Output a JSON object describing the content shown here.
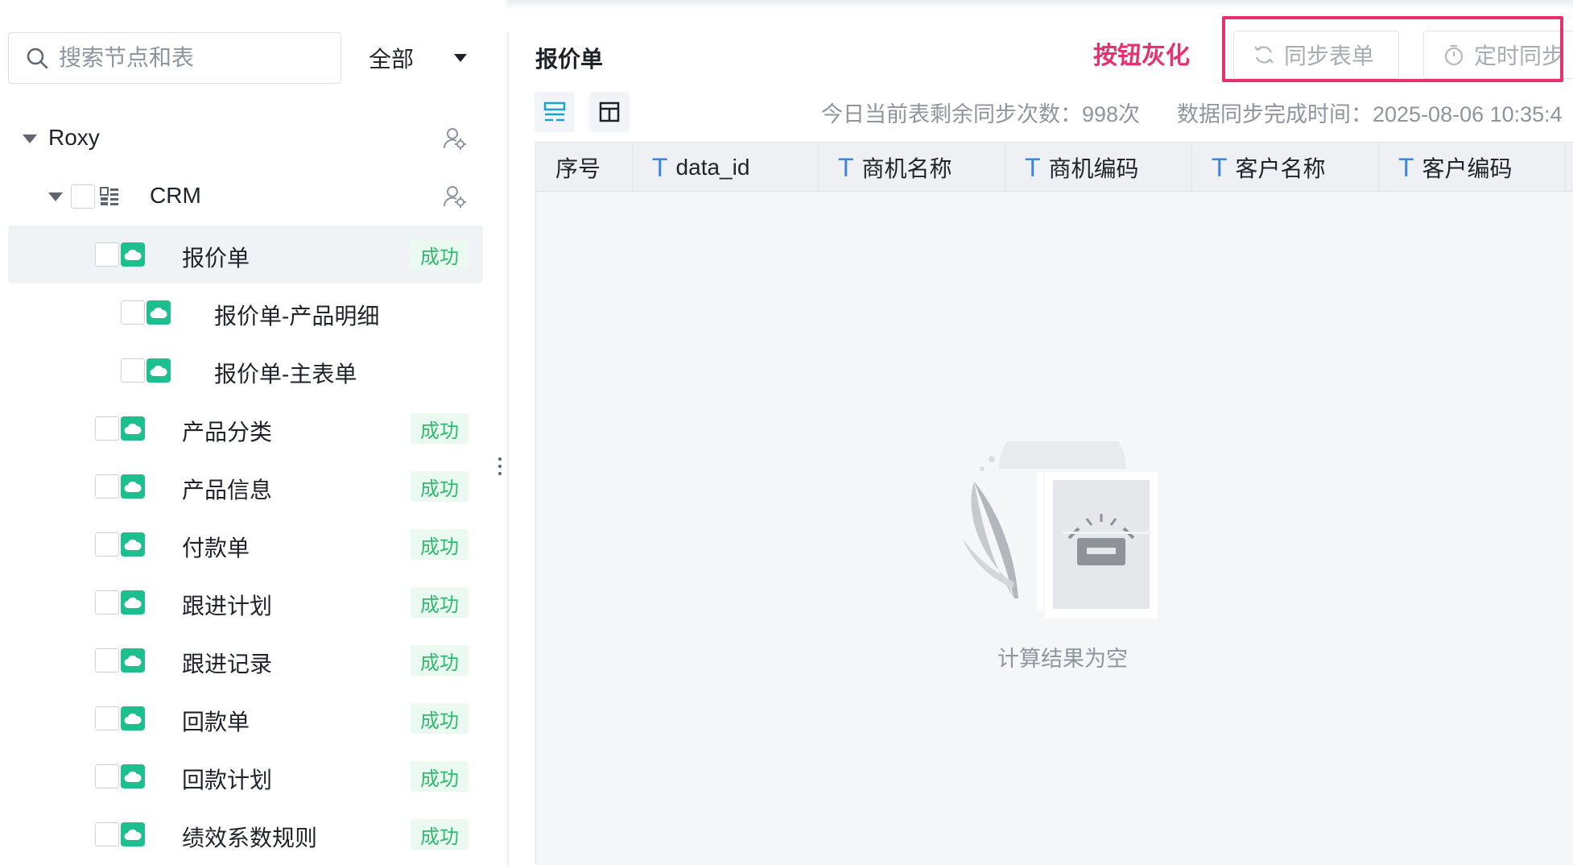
{
  "sidebar": {
    "search_placeholder": "搜索节点和表",
    "scope_select": "全部",
    "tree": [
      {
        "label": "Roxy",
        "level": 0,
        "expanded": true,
        "has_checkbox": false,
        "icon": "none",
        "has_person_icon": true
      },
      {
        "label": "CRM",
        "level": 1,
        "expanded": true,
        "has_checkbox": true,
        "icon": "app-grid-icon",
        "has_person_icon": true
      },
      {
        "label": "报价单",
        "level": 2,
        "selected": true,
        "icon": "cloud-icon",
        "status": "成功"
      },
      {
        "label": "报价单-产品明细",
        "level": 3,
        "icon": "cloud-icon",
        "status": ""
      },
      {
        "label": "报价单-主表单",
        "level": 3,
        "icon": "cloud-icon",
        "status": ""
      },
      {
        "label": "产品分类",
        "level": 2,
        "icon": "cloud-icon",
        "status": "成功"
      },
      {
        "label": "产品信息",
        "level": 2,
        "icon": "cloud-icon",
        "status": "成功"
      },
      {
        "label": "付款单",
        "level": 2,
        "icon": "cloud-icon",
        "status": "成功"
      },
      {
        "label": "跟进计划",
        "level": 2,
        "icon": "cloud-icon",
        "status": "成功"
      },
      {
        "label": "跟进记录",
        "level": 2,
        "icon": "cloud-icon",
        "status": "成功"
      },
      {
        "label": "回款单",
        "level": 2,
        "icon": "cloud-icon",
        "status": "成功"
      },
      {
        "label": "回款计划",
        "level": 2,
        "icon": "cloud-icon",
        "status": "成功"
      },
      {
        "label": "绩效系数规则",
        "level": 2,
        "icon": "cloud-icon",
        "status": "成功"
      }
    ]
  },
  "main": {
    "title": "报价单",
    "annotation": "按钮灰化",
    "buttons": {
      "sync_table": "同步表单",
      "scheduled_sync": "定时同步"
    },
    "meta": {
      "remaining_syncs": "今日当前表剩余同步次数：998次",
      "sync_time": "数据同步完成时间：2025-08-06 10:35:4"
    },
    "columns": [
      "序号",
      "data_id",
      "商机名称",
      "商机编码",
      "客户名称",
      "客户编码"
    ],
    "empty_text": "计算结果为空"
  },
  "colors": {
    "accent_pink": "#e8306f",
    "success_green": "#2dbb6e",
    "cloud_icon_bg": "#1dbf8f",
    "text_type_blue": "#3d84e6"
  }
}
